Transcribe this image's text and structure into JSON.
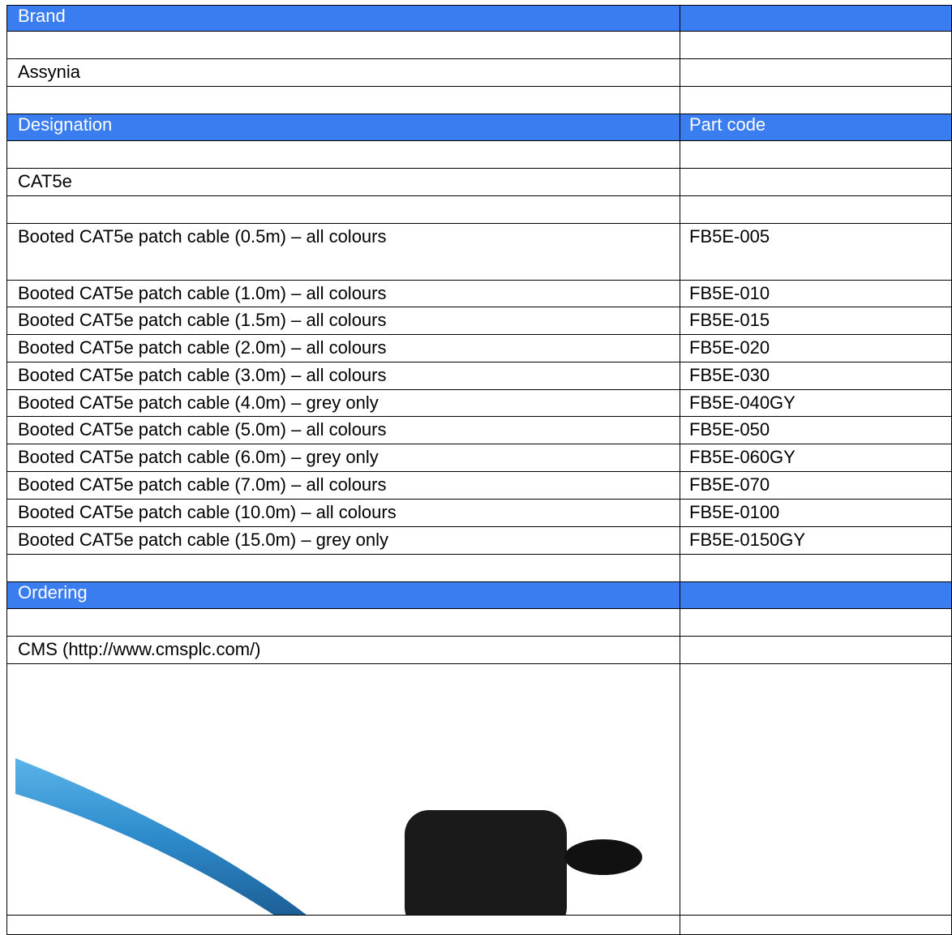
{
  "brand": {
    "header": "Brand",
    "value": "Assynia"
  },
  "product_table": {
    "col_designation": "Designation",
    "col_part_code": "Part code",
    "category": "CAT5e",
    "rows": [
      {
        "designation": "Booted CAT5e patch cable (0.5m) – all colours",
        "part_code": "FB5E-005"
      },
      {
        "designation": "Booted CAT5e patch cable (1.0m) – all colours",
        "part_code": "FB5E-010"
      },
      {
        "designation": "Booted CAT5e patch cable (1.5m) – all colours",
        "part_code": "FB5E-015"
      },
      {
        "designation": "Booted CAT5e patch cable (2.0m) – all colours",
        "part_code": "FB5E-020"
      },
      {
        "designation": "Booted CAT5e patch cable (3.0m) – all colours",
        "part_code": "FB5E-030"
      },
      {
        "designation": "Booted CAT5e patch cable (4.0m) – grey only",
        "part_code": "FB5E-040GY"
      },
      {
        "designation": "Booted CAT5e patch cable (5.0m) – all colours",
        "part_code": "FB5E-050"
      },
      {
        "designation": "Booted CAT5e patch cable (6.0m) – grey only",
        "part_code": "FB5E-060GY"
      },
      {
        "designation": "Booted CAT5e patch cable (7.0m) – all colours",
        "part_code": "FB5E-070"
      },
      {
        "designation": "Booted CAT5e patch cable (10.0m) – all colours",
        "part_code": "FB5E-0100"
      },
      {
        "designation": "Booted CAT5e patch cable (15.0m) – grey only",
        "part_code": "FB5E-0150GY"
      }
    ]
  },
  "ordering": {
    "header": "Ordering",
    "supplier": "CMS (http://www.cmsplc.com/)"
  },
  "colors": {
    "header_bg": "#3a7df0",
    "header_text": "#ffffff",
    "cable_blue": "#2f8fd0",
    "connector": "#1a1a1a"
  },
  "icons": {
    "product_image": "blue-patch-cable-photo"
  }
}
